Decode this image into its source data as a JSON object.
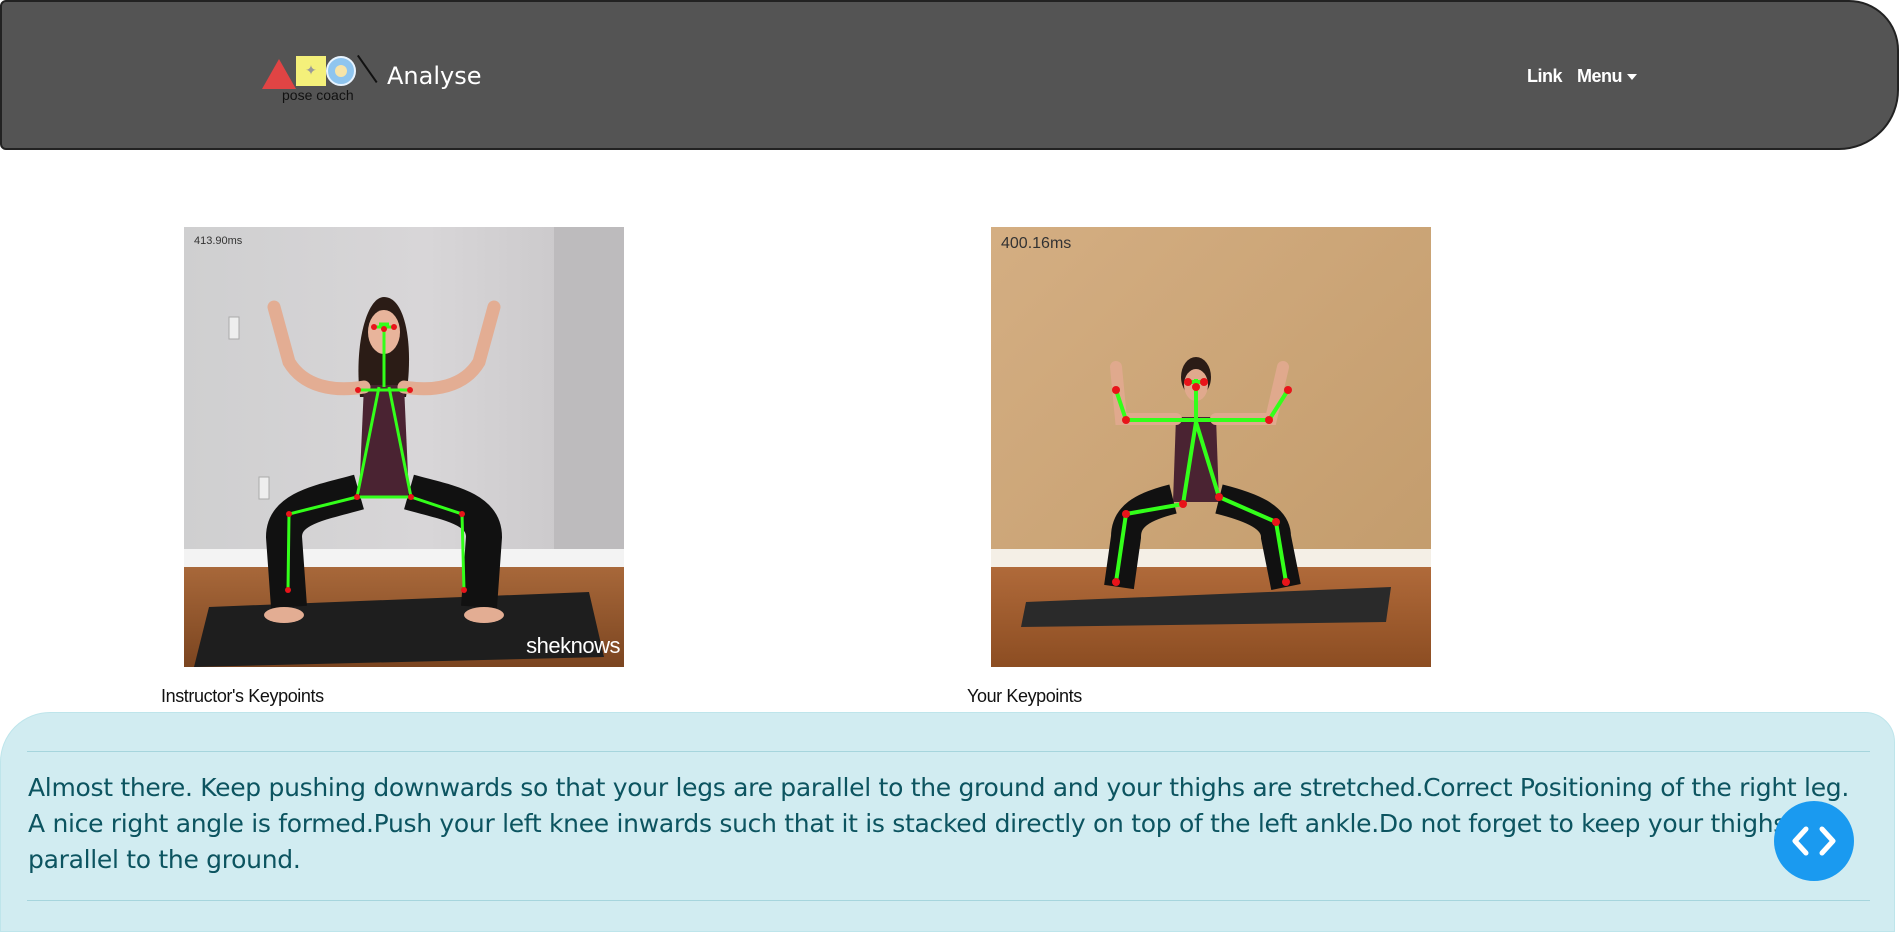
{
  "header": {
    "logo_caption": "pose coach",
    "brand": "Analyse",
    "nav_link": "Link",
    "nav_menu": "Menu"
  },
  "instructor": {
    "latency": "413.90ms",
    "watermark": "sheknows",
    "caption": "Instructor's Keypoints"
  },
  "user": {
    "latency": "400.16ms",
    "caption": "Your Keypoints"
  },
  "feedback": {
    "message": "Almost there. Keep pushing downwards so that your legs are parallel to the ground and your thighs are stretched.Correct Positioning of the right leg. A nice right angle is formed.Push your left knee inwards such that it is stacked directly on top of the left ankle.Do not forget to keep your thighs parallel to the ground."
  },
  "colors": {
    "navbar": "#545454",
    "alert_bg": "#d1ecf1",
    "alert_text": "#0c5460",
    "skeleton": "#33ff1a",
    "keypoint": "#e8141a",
    "fab": "#1a9af0"
  },
  "icons": {
    "fab": "code-brackets-icon"
  }
}
